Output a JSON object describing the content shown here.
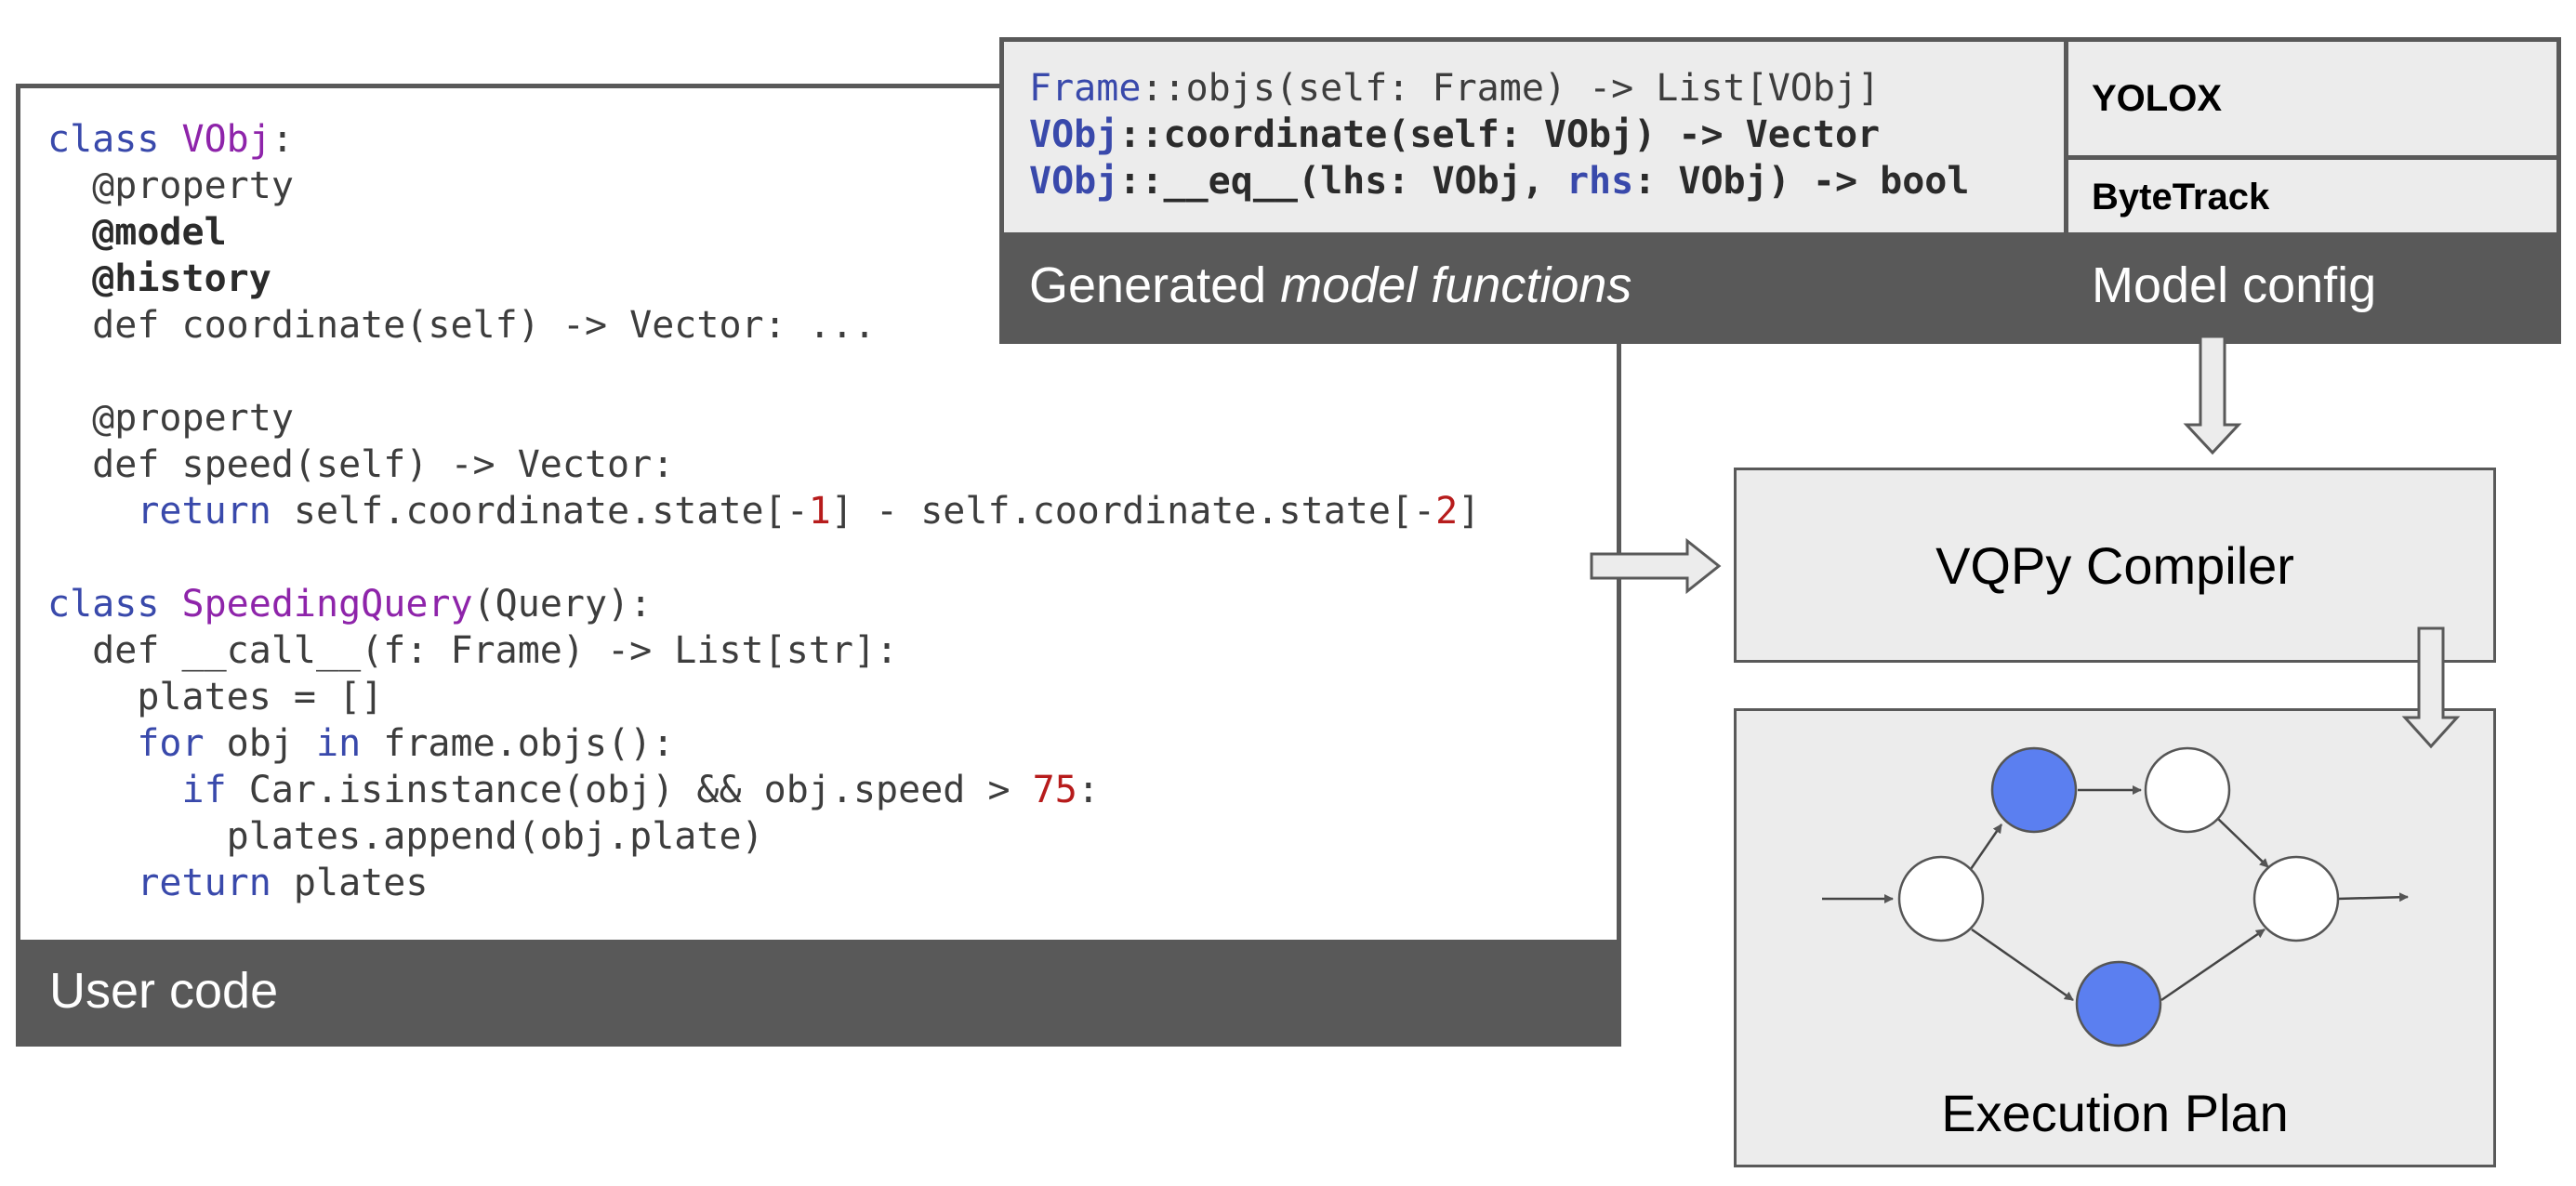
{
  "user_code": {
    "footer_label": "User code",
    "lines": [
      [
        {
          "t": "class ",
          "c": "kw"
        },
        {
          "t": "VObj",
          "c": "cls"
        },
        {
          "t": ":",
          "c": ""
        }
      ],
      [
        {
          "t": "  @property",
          "c": ""
        }
      ],
      [
        {
          "t": "  @model",
          "c": "b"
        }
      ],
      [
        {
          "t": "  @history",
          "c": "b"
        }
      ],
      [
        {
          "t": "  def coordinate(self) -> Vector: ...",
          "c": ""
        }
      ],
      [
        {
          "t": "",
          "c": ""
        }
      ],
      [
        {
          "t": "  @property",
          "c": ""
        }
      ],
      [
        {
          "t": "  def speed(self) -> Vector:",
          "c": ""
        }
      ],
      [
        {
          "t": "    ",
          "c": ""
        },
        {
          "t": "return",
          "c": "kw"
        },
        {
          "t": " self.coordinate.state[-",
          "c": ""
        },
        {
          "t": "1",
          "c": "num"
        },
        {
          "t": "] - self.coordinate.state[-",
          "c": ""
        },
        {
          "t": "2",
          "c": "num"
        },
        {
          "t": "]",
          "c": ""
        }
      ],
      [
        {
          "t": "",
          "c": ""
        }
      ],
      [
        {
          "t": "class ",
          "c": "kw"
        },
        {
          "t": "SpeedingQuery",
          "c": "cls"
        },
        {
          "t": "(Query):",
          "c": ""
        }
      ],
      [
        {
          "t": "  def __call__(f: Frame) -> List[str]:",
          "c": ""
        }
      ],
      [
        {
          "t": "    plates = []",
          "c": ""
        }
      ],
      [
        {
          "t": "    ",
          "c": ""
        },
        {
          "t": "for",
          "c": "kw"
        },
        {
          "t": " obj ",
          "c": ""
        },
        {
          "t": "in",
          "c": "kw"
        },
        {
          "t": " frame.objs():",
          "c": ""
        }
      ],
      [
        {
          "t": "      ",
          "c": ""
        },
        {
          "t": "if",
          "c": "kw"
        },
        {
          "t": " Car.isinstance(obj) && obj.speed > ",
          "c": ""
        },
        {
          "t": "75",
          "c": "num"
        },
        {
          "t": ":",
          "c": ""
        }
      ],
      [
        {
          "t": "        plates.append(obj.plate)",
          "c": ""
        }
      ],
      [
        {
          "t": "    ",
          "c": ""
        },
        {
          "t": "return",
          "c": "kw"
        },
        {
          "t": " plates",
          "c": ""
        }
      ]
    ]
  },
  "model_functions": {
    "footer_prefix": "Generated ",
    "footer_emphasis": "model functions",
    "lines": [
      {
        "bold": false,
        "parts": [
          {
            "t": "Frame",
            "c": "kw"
          },
          {
            "t": "::objs(self: Frame) -> List[VObj]",
            "c": ""
          }
        ]
      },
      {
        "bold": true,
        "parts": [
          {
            "t": "VObj",
            "c": "kw"
          },
          {
            "t": "::coordinate(self: VObj) -> Vector",
            "c": ""
          }
        ]
      },
      {
        "bold": true,
        "parts": [
          {
            "t": "VObj",
            "c": "kw"
          },
          {
            "t": "::__eq__(lhs: VObj, ",
            "c": ""
          },
          {
            "t": "rhs",
            "c": "kw"
          },
          {
            "t": ": VObj) -> bool",
            "c": ""
          }
        ]
      }
    ]
  },
  "model_config": {
    "label": "Model config",
    "items": [
      "YOLOX",
      "ByteTrack"
    ]
  },
  "compiler": {
    "label": "VQPy Compiler"
  },
  "execution_plan": {
    "label": "Execution Plan",
    "highlight_color": "#5b7ff0",
    "node_color": "#ffffff"
  }
}
